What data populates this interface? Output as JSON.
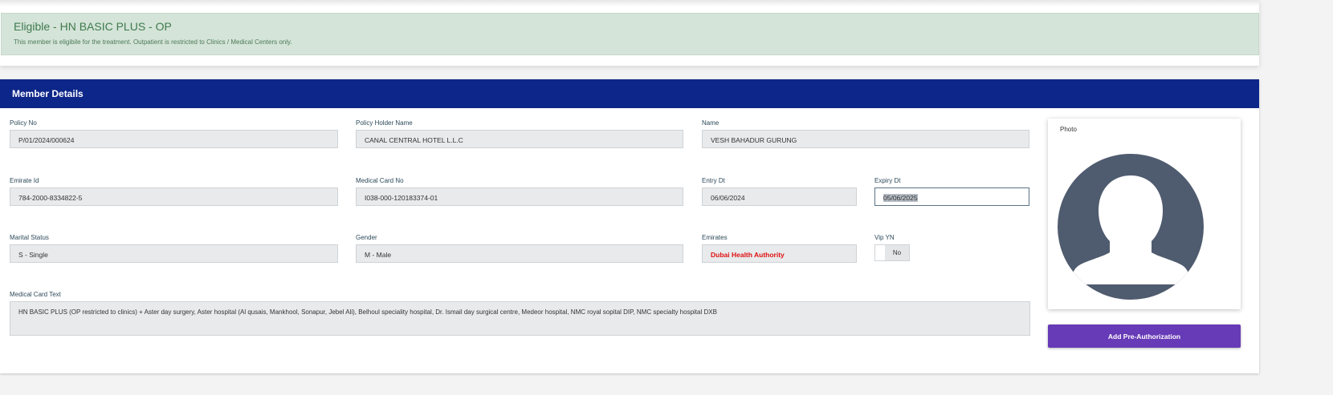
{
  "eligibility": {
    "title": "Eligible - HN BASIC PLUS - OP",
    "message": "This member is eligibile for the treatment. Outpatient is restricted to Clinics / Medical Centers only."
  },
  "member": {
    "header": "Member Details",
    "policy_no": {
      "label": "Policy No",
      "value": "P/01/2024/000624"
    },
    "policy_holder": {
      "label": "Policy Holder Name",
      "value": "CANAL CENTRAL HOTEL L.L.C"
    },
    "name": {
      "label": "Name",
      "value": "VESH BAHADUR GURUNG"
    },
    "emirate_id": {
      "label": "Emirate Id",
      "value": "784-2000-8334822-5"
    },
    "medical_card_no": {
      "label": "Medical Card No",
      "value": "I038-000-120183374-01"
    },
    "entry_dt": {
      "label": "Entry Dt",
      "value": "06/06/2024"
    },
    "expiry_dt": {
      "label": "Expiry Dt",
      "value": "05/06/2025"
    },
    "marital_status": {
      "label": "Marital Status",
      "value": "S - Single"
    },
    "gender": {
      "label": "Gender",
      "value": "M - Male"
    },
    "emirates": {
      "label": "Emirates",
      "value": "Dubai Health Authority"
    },
    "vip": {
      "label": "Vip YN",
      "value": "No"
    },
    "medical_card_text": {
      "label": "Medical Card Text",
      "value": "HN BASIC PLUS (OP restricted to clinics) + Aster day surgery, Aster hospital (Al qusais, Mankhool, Sonapur, Jebel Ali), Belhoul speciality hospital, Dr. Ismail day surgical centre, Medeor hospital, NMC royal sopital DIP,  NMC specialty hospital DXB"
    },
    "photo_label": "Photo",
    "add_preauth": "Add Pre-Authorization"
  }
}
